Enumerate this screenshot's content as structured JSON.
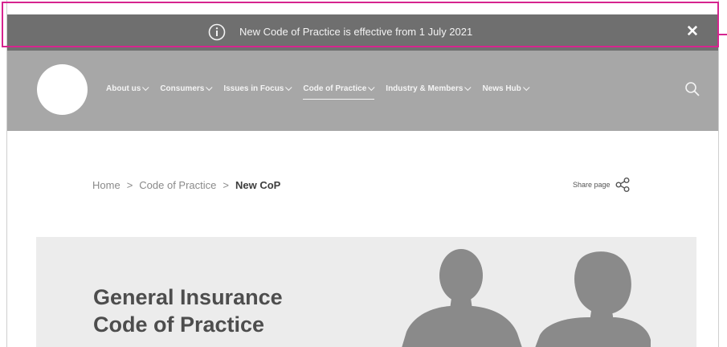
{
  "notice": {
    "message": "New Code of Practice is effective from 1 July 2021",
    "icon": "info-icon",
    "close_icon": "close-icon",
    "close_label": "✕"
  },
  "nav": {
    "items": [
      {
        "label": "About us"
      },
      {
        "label": "Consumers"
      },
      {
        "label": "Issues in Focus"
      },
      {
        "label": "Code of Practice"
      },
      {
        "label": "Industry & Members"
      },
      {
        "label": "News Hub"
      }
    ],
    "search_icon": "search-icon"
  },
  "breadcrumb": {
    "home": "Home",
    "section": "Code of Practice",
    "current": "New CoP",
    "separator": ">"
  },
  "share": {
    "label": "Share page",
    "icon": "share-icon"
  },
  "hero": {
    "title_line1": "General Insurance",
    "title_line2": "Code of Practice"
  },
  "colors": {
    "highlight": "#d6248f",
    "notice_bg": "#6f6f6f",
    "nav_bg": "#a7a7a7",
    "hero_bg": "#ececec"
  }
}
